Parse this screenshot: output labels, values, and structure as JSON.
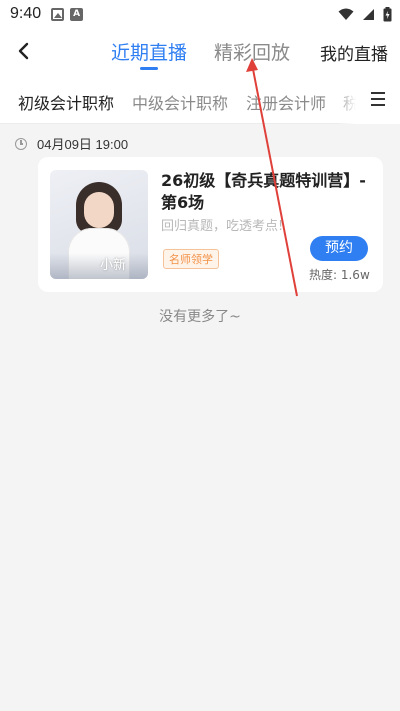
{
  "status_bar": {
    "time": "9:40"
  },
  "nav": {
    "tabs": [
      {
        "label": "近期直播"
      },
      {
        "label": "精彩回放"
      },
      {
        "label": "我的直播"
      }
    ]
  },
  "categories": [
    "初级会计职称",
    "中级会计职称",
    "注册会计师",
    "税"
  ],
  "date_label": "04月09日 19:00",
  "card": {
    "title": "26初级【奇兵真题特训营】-第6场",
    "subtitle": "回归真题，吃透考点!",
    "teacher_name": "小新",
    "tag": "名师领学",
    "button_label": "预约",
    "heat": "热度: 1.6w"
  },
  "footer_text": "没有更多了~",
  "colors": {
    "accent": "#2f7ff2",
    "tag": "#f29147",
    "annotation": "#e0403a"
  }
}
